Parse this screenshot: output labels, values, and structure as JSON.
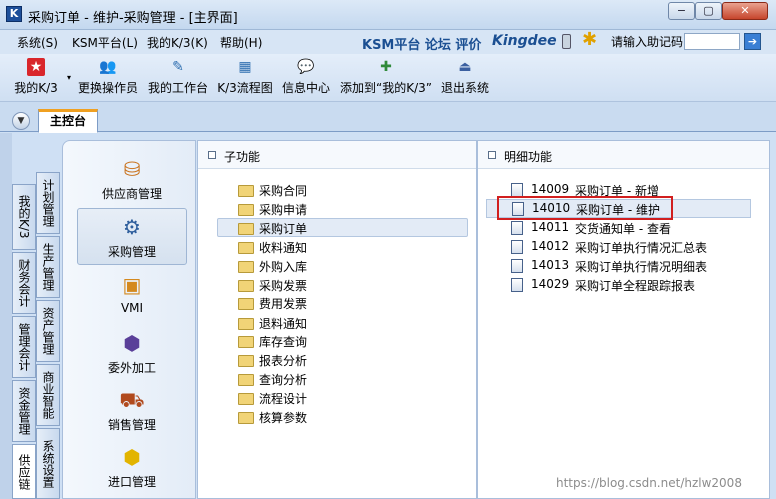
{
  "window": {
    "title": "采购订单 - 维护-采购管理 - [主界面]",
    "app_icon": "K",
    "controls": {
      "minimize": "−",
      "maximize": "▢",
      "close": "✕"
    }
  },
  "menubar": {
    "items": [
      "系统(S)",
      "KSM平台(L)",
      "我的K/3(K)",
      "帮助(H)"
    ],
    "brand_links": "KSM平台 论坛 评价",
    "brand_logo": "Kingdee",
    "help_label": "请输入助记码",
    "help_input_value": "",
    "go_glyph": "➔"
  },
  "toolbar": {
    "items": [
      {
        "label": "我的K/3",
        "icon": "star-icon",
        "glyph": "★",
        "color": "#d9262b"
      },
      {
        "label": "更换操作员",
        "icon": "users-icon",
        "glyph": "👥",
        "color": "#6a52a8"
      },
      {
        "label": "我的工作台",
        "icon": "pencil-icon",
        "glyph": "✎",
        "color": "#2f6fb0"
      },
      {
        "label": "K/3流程图",
        "icon": "flowchart-icon",
        "glyph": "▦",
        "color": "#2f6fb0"
      },
      {
        "label": "信息中心",
        "icon": "chat-icon",
        "glyph": "💬",
        "color": "#c08a1e"
      },
      {
        "label": "添加到“我的K/3”",
        "icon": "add-favorite-icon",
        "glyph": "✚",
        "color": "#2f8a3a"
      },
      {
        "label": "退出系统",
        "icon": "exit-icon",
        "glyph": "⏏",
        "color": "#3a5fa0"
      }
    ]
  },
  "tabs": {
    "dropdown_glyph": "▼",
    "main": "主控台"
  },
  "vertical_tabs": {
    "outer": [
      "我的K/3",
      "财务会计",
      "管理会计",
      "资金管理",
      "供应链"
    ],
    "inner": [
      "计划管理",
      "生产管理",
      "资产管理",
      "商业智能",
      "系统设置"
    ]
  },
  "nav_modules": [
    {
      "label": "供应商管理",
      "icon": "supplier-icon",
      "glyph": "⛁",
      "color": "#c9731e"
    },
    {
      "label": "采购管理",
      "icon": "purchase-icon",
      "glyph": "⚙",
      "color": "#2e5e9c",
      "selected": true
    },
    {
      "label": "VMI",
      "icon": "vmi-icon",
      "glyph": "▣",
      "color": "#d4891e"
    },
    {
      "label": "委外加工",
      "icon": "outsourcing-icon",
      "glyph": "⬢",
      "color": "#5a3f99"
    },
    {
      "label": "销售管理",
      "icon": "sales-truck-icon",
      "glyph": "⛟",
      "color": "#b14a1e"
    },
    {
      "label": "进口管理",
      "icon": "import-icon",
      "glyph": "⬢",
      "color": "#e2b400"
    }
  ],
  "subfunctions": {
    "header": "子功能",
    "items": [
      "采购合同",
      "采购申请",
      "采购订单",
      "收料通知",
      "外购入库",
      "采购发票",
      "费用发票",
      "退料通知",
      "库存查询",
      "报表分析",
      "查询分析",
      "流程设计",
      "核算参数"
    ],
    "selected": "采购订单"
  },
  "details": {
    "header": "明细功能",
    "items": [
      {
        "code": "14009",
        "name": "采购订单 - 新增"
      },
      {
        "code": "14010",
        "name": "采购订单 - 维护",
        "selected": true
      },
      {
        "code": "14011",
        "name": "交货通知单 - 查看"
      },
      {
        "code": "14012",
        "name": "采购订单执行情况汇总表"
      },
      {
        "code": "14013",
        "name": "采购订单执行情况明细表"
      },
      {
        "code": "14029",
        "name": "采购订单全程跟踪报表"
      }
    ]
  },
  "watermark": "https://blog.csdn.net/hzlw2008",
  "colors": {
    "accent": "#1b4f92",
    "highlight": "#d11f1f",
    "tab_active": "#f0a020"
  }
}
